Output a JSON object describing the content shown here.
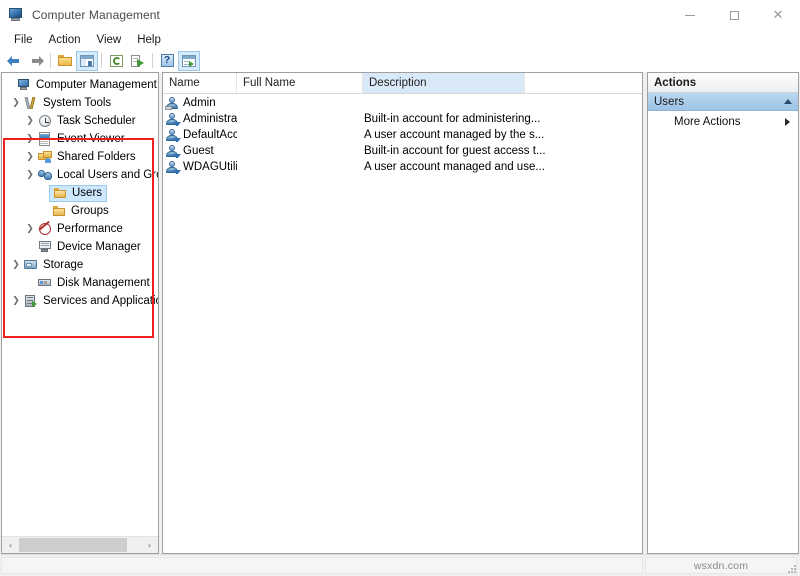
{
  "window": {
    "title": "Computer Management",
    "icon": "computer-management-icon",
    "controls": {
      "minimize": "minimize",
      "maximize": "maximize",
      "close": "close"
    }
  },
  "menubar": {
    "items": [
      {
        "label": "File"
      },
      {
        "label": "Action"
      },
      {
        "label": "View"
      },
      {
        "label": "Help"
      }
    ]
  },
  "toolbar": {
    "buttons": [
      {
        "icon": "back-arrow-icon",
        "label": "Back"
      },
      {
        "icon": "forward-arrow-icon",
        "label": "Forward"
      },
      {
        "icon": "up-folder-icon",
        "label": "Up One Level"
      },
      {
        "icon": "show-hide-console-tree-icon",
        "label": "Show/Hide Console Tree",
        "pressed": true
      },
      {
        "icon": "refresh-icon",
        "label": "Refresh"
      },
      {
        "icon": "export-list-icon",
        "label": "Export List"
      },
      {
        "icon": "help-icon",
        "label": "Help"
      },
      {
        "icon": "show-hide-action-pane-icon",
        "label": "Show/Hide Action Pane",
        "pressed": true
      }
    ]
  },
  "tree": {
    "nodes": [
      {
        "label": "Computer Management (Loca",
        "icon": "computer-management-icon",
        "indent": 0,
        "twisty": "",
        "selected": false
      },
      {
        "label": "System Tools",
        "icon": "system-tools-icon",
        "indent": 1,
        "twisty": "expanded",
        "selected": false
      },
      {
        "label": "Task Scheduler",
        "icon": "task-scheduler-icon",
        "indent": 2,
        "twisty": "collapsed",
        "selected": false
      },
      {
        "label": "Event Viewer",
        "icon": "event-viewer-icon",
        "indent": 2,
        "twisty": "collapsed",
        "selected": false
      },
      {
        "label": "Shared Folders",
        "icon": "shared-folders-icon",
        "indent": 2,
        "twisty": "collapsed",
        "selected": false
      },
      {
        "label": "Local Users and Groups",
        "icon": "local-users-and-groups-icon",
        "indent": 2,
        "twisty": "expanded",
        "selected": false
      },
      {
        "label": "Users",
        "icon": "folder-icon",
        "indent": 3,
        "twisty": "",
        "selected": true
      },
      {
        "label": "Groups",
        "icon": "folder-icon",
        "indent": 3,
        "twisty": "",
        "selected": false
      },
      {
        "label": "Performance",
        "icon": "performance-icon",
        "indent": 2,
        "twisty": "collapsed",
        "selected": false
      },
      {
        "label": "Device Manager",
        "icon": "device-manager-icon",
        "indent": 2,
        "twisty": "",
        "selected": false
      },
      {
        "label": "Storage",
        "icon": "storage-icon",
        "indent": 1,
        "twisty": "expanded",
        "selected": false
      },
      {
        "label": "Disk Management",
        "icon": "disk-management-icon",
        "indent": 2,
        "twisty": "",
        "selected": false
      },
      {
        "label": "Services and Applications",
        "icon": "services-and-applications-icon",
        "indent": 1,
        "twisty": "collapsed",
        "selected": false
      }
    ],
    "scrollbar": {
      "left_arrow": "‹",
      "right_arrow": "›"
    },
    "annotation": {
      "shape": "rectangle",
      "color": "#ee2020"
    }
  },
  "list": {
    "columns": [
      {
        "key": "name",
        "label": "Name",
        "highlighted": false
      },
      {
        "key": "full_name",
        "label": "Full Name",
        "highlighted": false
      },
      {
        "key": "description",
        "label": "Description",
        "highlighted": true
      }
    ],
    "highlight_color": "#d9e9f7",
    "rows": [
      {
        "name": "Admin",
        "full_name": "",
        "description": "",
        "icon": "user-account-icon"
      },
      {
        "name": "Administrator",
        "full_name": "",
        "description": "Built-in account for administering...",
        "icon": "user-account-disabled-icon"
      },
      {
        "name": "DefaultAcco...",
        "full_name": "",
        "description": "A user account managed by the s...",
        "icon": "user-account-disabled-icon"
      },
      {
        "name": "Guest",
        "full_name": "",
        "description": "Built-in account for guest access t...",
        "icon": "user-account-disabled-icon"
      },
      {
        "name": "WDAGUtility...",
        "full_name": "",
        "description": "A user account managed and use...",
        "icon": "user-account-disabled-icon"
      }
    ]
  },
  "actions": {
    "title": "Actions",
    "group": {
      "label": "Users",
      "collapse_icon": "chevron-up-icon"
    },
    "items": [
      {
        "label": "More Actions",
        "submenu_icon": "chevron-right-icon"
      }
    ]
  },
  "statusbar": {
    "text": "",
    "watermark": "wsxdn.com"
  }
}
